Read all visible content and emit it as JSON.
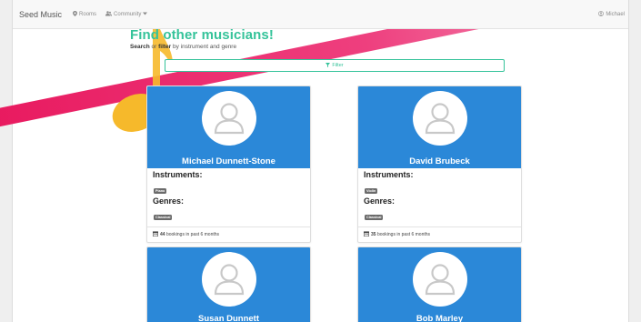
{
  "navbar": {
    "brand": "Seed Music",
    "rooms_label": "Rooms",
    "community_label": "Community",
    "user_label": "Michael"
  },
  "header": {
    "title": "Find other musicians!",
    "subtitle_search": "Search",
    "subtitle_or": " or ",
    "subtitle_filter": "filter",
    "subtitle_rest": " by instrument and genre"
  },
  "filter_button": {
    "label": "Filter"
  },
  "labels": {
    "instruments": "Instruments:",
    "genres": "Genres:",
    "bookings_suffix": " bookings in past 6 months"
  },
  "musicians": [
    {
      "name": "Michael Dunnett-Stone",
      "instrument": "Piano",
      "genre": "Classical",
      "bookings": "44"
    },
    {
      "name": "David Brubeck",
      "instrument": "Violin",
      "genre": "Classical",
      "bookings": "35"
    },
    {
      "name": "Susan Dunnett"
    },
    {
      "name": "Bob Marley"
    }
  ],
  "colors": {
    "accent_green": "#35c39a",
    "card_blue": "#2b88d8",
    "stripe_pink": "#e8175d",
    "note_yellow": "#f6b92b"
  },
  "icons": {
    "rooms": "map-pin-icon",
    "community": "users-icon",
    "user": "user-icon",
    "filter": "filter-icon",
    "bookings": "calendar-icon",
    "avatar": "user-avatar-icon"
  }
}
